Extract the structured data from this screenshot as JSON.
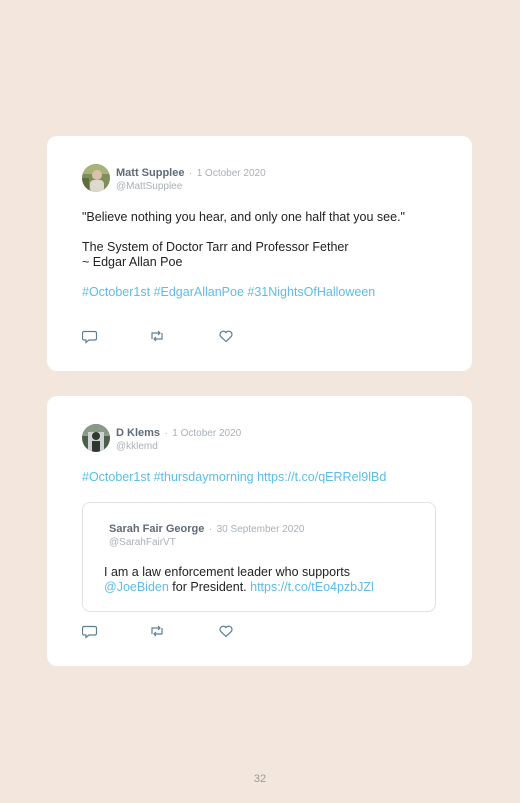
{
  "tweets": [
    {
      "author": "Matt Supplee",
      "separator": "·",
      "date": "1 October 2020",
      "handle": "@MattSupplee",
      "line1": "\"Believe nothing you hear, and only one half that you see.\"",
      "line2": "The System of Doctor Tarr and Professor Fether",
      "line3": "~ Edgar Allan Poe",
      "hashtags": "#October1st #EdgarAllanPoe #31NightsOfHalloween"
    },
    {
      "author": "D Klems",
      "separator": "·",
      "date": "1 October 2020",
      "handle": "@kklemd",
      "text_link": "#October1st #thursdaymorning https://t.co/qERRel9lBd",
      "quote": {
        "author": "Sarah Fair George",
        "separator": "·",
        "date": "30 September 2020",
        "handle": "@SarahFairVT",
        "text_prefix": "I am a law enforcement leader who supports",
        "mention": "@JoeBiden",
        "text_middle": " for President. ",
        "url": "https://t.co/tEo4pzbJZl"
      }
    }
  ],
  "icons": [
    "reply-icon",
    "retweet-icon",
    "like-icon"
  ],
  "colors": {
    "background": "#f3e6dc",
    "card": "#ffffff",
    "link": "#5cbde6",
    "icon": "#5e7f93"
  },
  "page_number": "32"
}
